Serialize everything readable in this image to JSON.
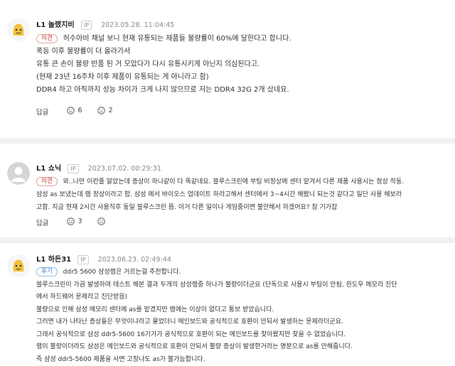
{
  "comments": [
    {
      "nickname": "L1 놀랬지비",
      "ip_tag": "IP",
      "date": "2023.05.28. 11:04:45",
      "badge": "의견",
      "lines": [
        "허수아비 채널 보니 현재 유통되는 제품들 불량률이 60%에 달한다고 합니다.",
        "폭등 이후 불량률이 더 올라가서",
        "유통 큰 손이 불량 반품 된 거 모았다가 다시 유통시키게 아닌지 의심된다고.",
        "(현재 23년 16주차 이후 제품이 유통되는 게 아니라고 함)",
        "DDR4 하고 아직까지 성능 차이가 크게 나지 않으므로 저는 DDR4 32G 2개 샀네요."
      ],
      "reply_label": "답글",
      "upvotes": "6",
      "downvotes": "2"
    },
    {
      "nickname": "L1 쇼닉",
      "ip_tag": "IP",
      "date": "2023.07.02. 00:29:31",
      "badge": "의견",
      "lines": [
        "와..나만 이런줄 알았는데 증상이 하나같이 다 똑같네요. 블루스크린에 부팅 비정상에 센터 맡겨서 다른 제품 사용시는 정상 작동.",
        "삼성 as 보냈는데 램 정상이라고 함. 삼성 에서 바이오스 업데이트 하라고해서 센터에서 3~4시간 해봤니 되는것 같다고 일단 사용 해보라",
        "고함. 지금 현재 2시간 사용직후 동일 블루스크린 뜸. 이거 다른 일이나 게임중이면 불안해서 하겠어요? 참 기가찹"
      ],
      "reply_label": "답글",
      "upvotes": "3",
      "downvotes": ""
    },
    {
      "nickname": "L1 하든31",
      "ip_tag": "IP",
      "date": "2023.06.23. 02:49:44",
      "badge": "후기",
      "lines": [
        "ddr5 5600 삼성램은 거르는걸 추천합니다.",
        "블루스크린이 가끔 발생하여 테스트 해본 결과 두개의 삼성램중 하나가 불량이더군요 (단독으로 사용시 부팅이 안됨, 윈도우 메모리 진단",
        "에서 하드웨어 문제라고 진단받음)",
        "불량으로 인해 삼성 메모리 센터에 as를 맡겼지만 램에는 이상이 없다고 통보 받았습니다.",
        "그러면 내가 나타난 증상들은 무엇이냐라고 물었더니 메인보드와 공식적으로 호환이 안되서 발생하는 문제라더군요.",
        "그래서 공식적으로 삼성 ddr5-5600 16기가가 공식적으로 호환이 되는 메인보드를 찾아봤지만 찾을 수 없었습니다.",
        "램이 불량이더라도 삼성은 메인보드와 공식적으로 호환이 안되서 불량 증상이 발생한거라는 명분으로 as를 안해줍니다.",
        "즉 삼성 ddr5-5600 제품을 사면 고장나도 as가 불가능합니다."
      ]
    }
  ],
  "colors": {
    "opinion_badge": "#c0392b",
    "review_badge": "#2a7ac2",
    "divider": "#f1f1f1"
  },
  "icons": {
    "upvote": "smile-icon",
    "downvote": "frown-icon",
    "avatar_lego": "lego-avatar-icon",
    "avatar_default": "default-avatar-icon"
  }
}
